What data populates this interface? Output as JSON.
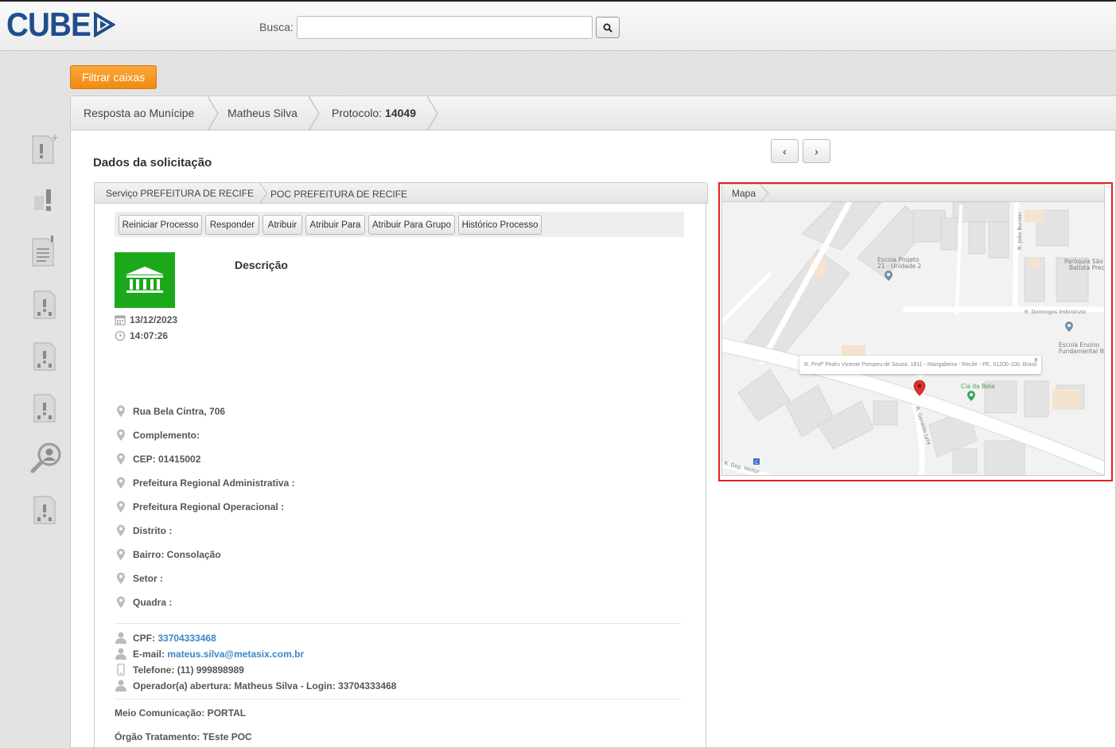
{
  "header": {
    "logo": "CUBE",
    "search_label": "Busca:",
    "search_value": "",
    "search_icon": "search-icon"
  },
  "sidebar": {
    "icons": [
      "report-add-icon",
      "alert-icon",
      "document-alert-icon",
      "person-document-icon",
      "person-document-icon",
      "person-document-icon",
      "search-user-icon",
      "person-document-icon"
    ]
  },
  "filter_button": "Filtrar caixas",
  "breadcrumb": {
    "items": [
      "Resposta ao Munícipe",
      "Matheus Silva"
    ],
    "protocol_label": "Protocolo:",
    "protocol_number": "14049"
  },
  "pager": {
    "prev": "‹",
    "next": "›"
  },
  "section_title": "Dados da solicitação",
  "service_tabs": [
    "Serviço PREFEITURA DE RECIFE",
    "POC PREFEITURA DE RECIFE"
  ],
  "actions": [
    "Reiniciar Processo",
    "Responder",
    "Atribuir",
    "Atribuir Para",
    "Atribuir Para Grupo",
    "Histórico Processo"
  ],
  "request": {
    "description_title": "Descrição",
    "date": "13/12/2023",
    "time": "14:07:26"
  },
  "address": [
    "Rua Bela Cintra, 706",
    "Complemento:",
    "CEP: 01415002",
    "Prefeitura Regional Administrativa :",
    "Prefeitura Regional Operacional :",
    "Distrito :",
    "Bairro: Consolação",
    "Setor :",
    "Quadra :"
  ],
  "contact": {
    "cpf_label": "CPF:",
    "cpf": "33704333468",
    "email_label": "E-mail:",
    "email": "mateus.silva@metasix.com.br",
    "phone": "Telefone: (11) 999898989",
    "operator": "Operador(a) abertura: Matheus Silva - Login: 33704333468"
  },
  "extra": {
    "channel": "Meio Comunicação: PORTAL",
    "organ": "Órgão Tratamento: TEste POC"
  },
  "map": {
    "tab": "Mapa",
    "popup": "R. Profª Pedro Vicente Pompeu de Souza, 1811 - Mangabeira - Recife - PE, 51200-100, Brasil",
    "labels": {
      "school1a": "Escola Projeto",
      "school1b": "21 - Unidade 2",
      "parish1": "Paróquia São",
      "parish2": "Batista Precu",
      "street1": "R. Domingos Imbroinzio",
      "street2": "R. João Burnier",
      "school2a": "Escola Ensino",
      "school2b": "Fundamental W",
      "place": "Cia da Bela",
      "street3": "R. Geraldo Lyra",
      "street4": "R. Dep. Heitor",
      "bus": "C"
    }
  },
  "colors": {
    "accent_orange": "#f39a1c",
    "brand_blue": "#1e4f8c",
    "link_blue": "#3a87c8",
    "gov_green": "#1ba91b",
    "highlight_red": "#e8201e"
  }
}
